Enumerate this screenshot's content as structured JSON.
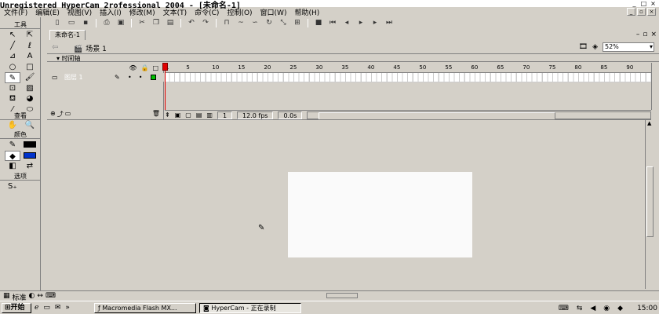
{
  "title_bar": {
    "title": "Unregistered HyperCam 2",
    "title_tail": "rofessional 2004 - [未命名-1]"
  },
  "menu": {
    "items": [
      "文件(F)",
      "编辑(E)",
      "视图(V)",
      "插入(I)",
      "修改(M)",
      "文本(T)",
      "命令(C)",
      "控制(O)",
      "窗口(W)",
      "帮助(H)"
    ]
  },
  "tools": {
    "header_tools": "工具",
    "header_view": "查看",
    "header_colors": "颜色",
    "header_options": "选项"
  },
  "document": {
    "tab_label": "未命名-1",
    "scene_label": "场景 1",
    "zoom": "52%",
    "timeline_label": "时间轴"
  },
  "timeline": {
    "layer_name": "图层 1",
    "ruler_numbers": [
      "1",
      "5",
      "10",
      "15",
      "20",
      "25",
      "30",
      "35",
      "40",
      "45",
      "50",
      "55",
      "60",
      "65",
      "70",
      "75",
      "80",
      "85",
      "90"
    ],
    "current_frame": "1",
    "frame_rate": "12.0 fps",
    "elapsed": "0.0s"
  },
  "bottom_bar": {
    "standard_label": "标准"
  },
  "taskbar": {
    "start_label": "开始",
    "tasks": [
      "Macromedia Flash MX...",
      "HyperCam - 正在录制"
    ],
    "clock": "15:00"
  }
}
